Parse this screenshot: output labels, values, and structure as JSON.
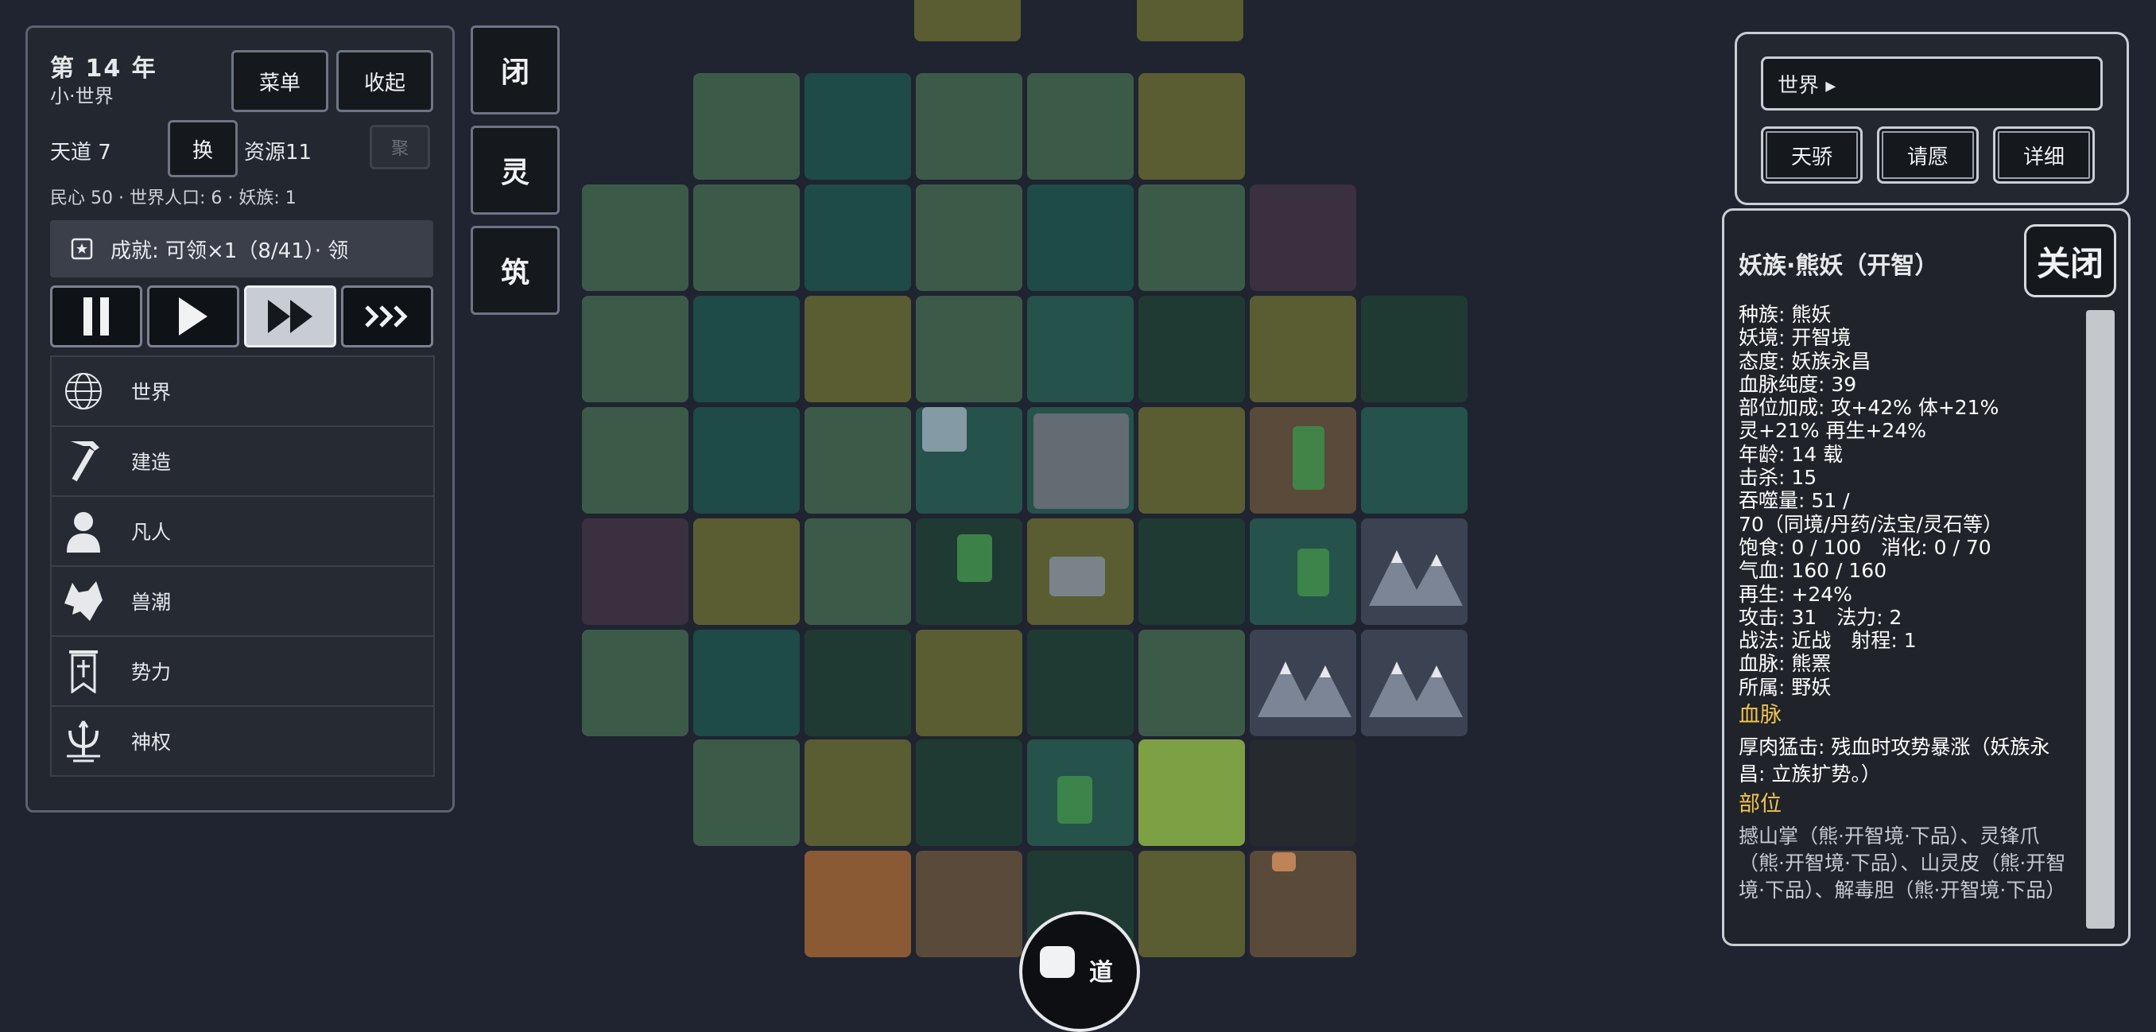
{
  "header": {
    "year": "第 14 年",
    "world_name": "小·世界",
    "tiandao": "天道 7",
    "swap_label": "换",
    "resources": "资源11",
    "gather_label": "聚",
    "stats": "民心 50 · 世界人口: 6 · 妖族: 1",
    "menu_label": "菜单",
    "collapse_label": "收起"
  },
  "achievement": {
    "text": "成就: 可领×1（8/41）· 领"
  },
  "speed": {
    "active": "fast"
  },
  "menu": {
    "items": [
      {
        "label": "世界",
        "icon": "globe-icon"
      },
      {
        "label": "建造",
        "icon": "hammer-icon"
      },
      {
        "label": "凡人",
        "icon": "person-icon"
      },
      {
        "label": "兽潮",
        "icon": "wolf-icon"
      },
      {
        "label": "势力",
        "icon": "banner-icon"
      },
      {
        "label": "神权",
        "icon": "trident-icon"
      }
    ]
  },
  "side_buttons": [
    "闭",
    "灵",
    "筑"
  ],
  "right_top": {
    "world_field": "世界 ▸",
    "buttons": [
      "天骄",
      "请愿",
      "详细"
    ]
  },
  "detail": {
    "title": "妖族·熊妖（开智）",
    "close_label": "关闭",
    "lines": [
      "种族: 熊妖",
      "妖境: 开智境",
      "态度: 妖族永昌",
      "血脉纯度: 39",
      "部位加成: 攻+42% 体+21%",
      "灵+21% 再生+24%",
      "年龄: 14 载",
      "击杀: 15",
      "吞噬量: 51 /",
      "70（同境/丹药/法宝/灵石等）",
      "饱食: 0 / 100　消化: 0 / 70",
      "气血: 160 / 160",
      "再生: +24%",
      "攻击: 31　法力: 2",
      "战法: 近战　射程: 1",
      "血脉: 熊罴",
      "所属: 野妖"
    ],
    "bloodline_heading": "血脉",
    "bloodline_text": "厚肉猛击: 残血时攻势暴涨（妖族永昌: 立族扩势。）",
    "parts_heading": "部位",
    "parts_text": "撼山掌（熊·开智境·下品）、灵锋爪（熊·开智境·下品）、山灵皮（熊·开智境·下品）、解毒胆（熊·开智境·下品）"
  },
  "bottom": {
    "dao_label": "道"
  },
  "colors": {
    "panel_bg": "#23272f",
    "background": "#1f2430",
    "section_heading": "#f0c34e"
  }
}
